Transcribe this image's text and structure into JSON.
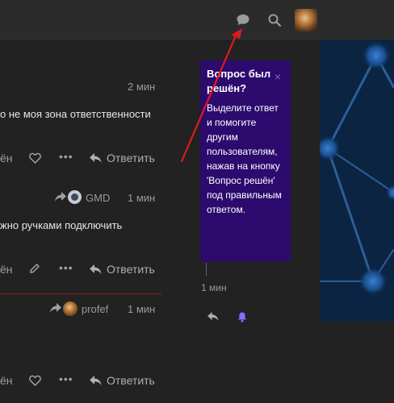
{
  "header": {
    "icons": [
      "chat-bubble-icon",
      "search-icon"
    ],
    "avatar": "user-avatar"
  },
  "posts": [
    {
      "time": "2 мин",
      "text": "о не моя зона ответственности",
      "left_fragment": "ён",
      "reply_label": "Ответить"
    },
    {
      "reply_to": "GMD",
      "time": "1 мин",
      "text": "жно ручками подключить",
      "left_fragment": "ён",
      "reply_label": "Ответить"
    },
    {
      "reply_to": "profef",
      "time": "1 мин",
      "left_fragment": "ён",
      "reply_label": "Ответить"
    }
  ],
  "popup": {
    "title": "Вопрос был решён?",
    "body": "Выделите ответ и помогите другим пользователям, нажав на кнопку 'Вопрос решён' под правильным ответом.",
    "close": "×"
  },
  "timeline": {
    "time": "1 мин"
  },
  "colors": {
    "popup_bg": "#2c0a6e",
    "arrow": "#e0191e",
    "bell": "#8b6cff"
  }
}
